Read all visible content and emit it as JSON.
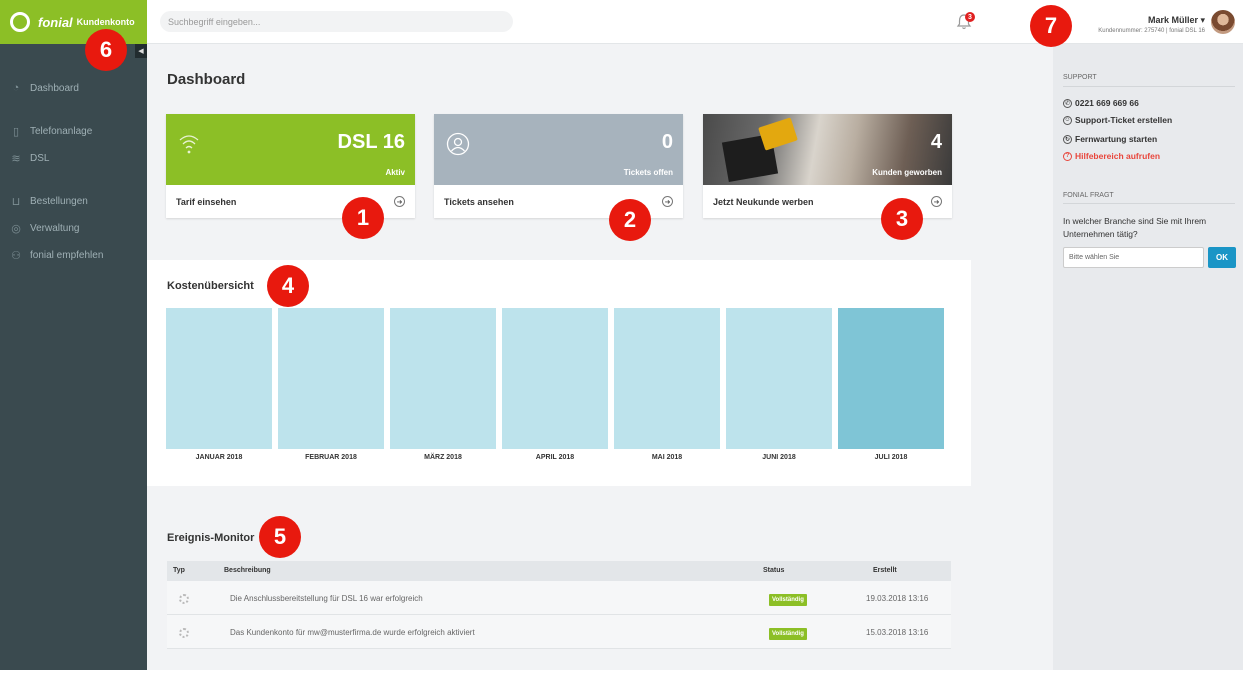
{
  "brand": {
    "name": "fonial",
    "subtitle": "Kundenkonto"
  },
  "sidebar": {
    "items": [
      {
        "label": "Dashboard",
        "icon": "gauge-icon"
      },
      {
        "label": "Telefonanlage",
        "icon": "phone-system-icon"
      },
      {
        "label": "DSL",
        "icon": "wifi-icon"
      },
      {
        "label": "Bestellungen",
        "icon": "cart-icon"
      },
      {
        "label": "Verwaltung",
        "icon": "user-circle-icon"
      },
      {
        "label": "fonial empfehlen",
        "icon": "people-icon"
      }
    ]
  },
  "search": {
    "placeholder": "Suchbegriff eingeben..."
  },
  "notifications": {
    "count": "3"
  },
  "user": {
    "name": "Mark Müller ▾",
    "details": "Kundennummer: 275740 | fonial DSL 16"
  },
  "page": {
    "title": "Dashboard"
  },
  "cards": [
    {
      "big": "DSL 16",
      "small": "Aktiv",
      "link": "Tarif einsehen"
    },
    {
      "big": "0",
      "small": "Tickets offen",
      "link": "Tickets ansehen"
    },
    {
      "big": "4",
      "small": "Kunden geworben",
      "link": "Jetzt Neukunde werben"
    }
  ],
  "costs": {
    "title": "Kostenübersicht",
    "months": [
      "JANUAR 2018",
      "FEBRUAR 2018",
      "MÄRZ 2018",
      "APRIL 2018",
      "MAI 2018",
      "JUNI 2018",
      "JULI 2018"
    ],
    "active_index": 6
  },
  "events": {
    "title": "Ereignis-Monitor",
    "columns": [
      "Typ",
      "Beschreibung",
      "Status",
      "Erstellt"
    ],
    "rows": [
      {
        "description": "Die Anschlussbereitstellung für DSL 16 war erfolgreich",
        "status": "Vollständig",
        "created": "19.03.2018 13:16"
      },
      {
        "description": "Das Kundenkonto für mw@musterfirma.de wurde erfolgreich aktiviert",
        "status": "Vollständig",
        "created": "15.03.2018 13:16"
      }
    ]
  },
  "support": {
    "heading": "SUPPORT",
    "phone": "0221 669 669 66",
    "ticket": "Support-Ticket erstellen",
    "remote": "Fernwartung starten",
    "help": "Hilfebereich aufrufen"
  },
  "survey": {
    "heading": "FONIAL FRAGT",
    "question": "In welcher Branche sind Sie mit Ihrem Unternehmen tätig?",
    "select_placeholder": "Bitte wählen Sie",
    "ok": "OK"
  },
  "callouts": [
    "1",
    "2",
    "3",
    "4",
    "5",
    "6",
    "7"
  ],
  "colors": {
    "brand_green": "#8cbf26",
    "sidebar": "#3a4a4f",
    "bar": "#bde3ec",
    "bar_active": "#7fc5d6",
    "accent_blue": "#1a95c6",
    "callout_red": "#e8190e"
  }
}
